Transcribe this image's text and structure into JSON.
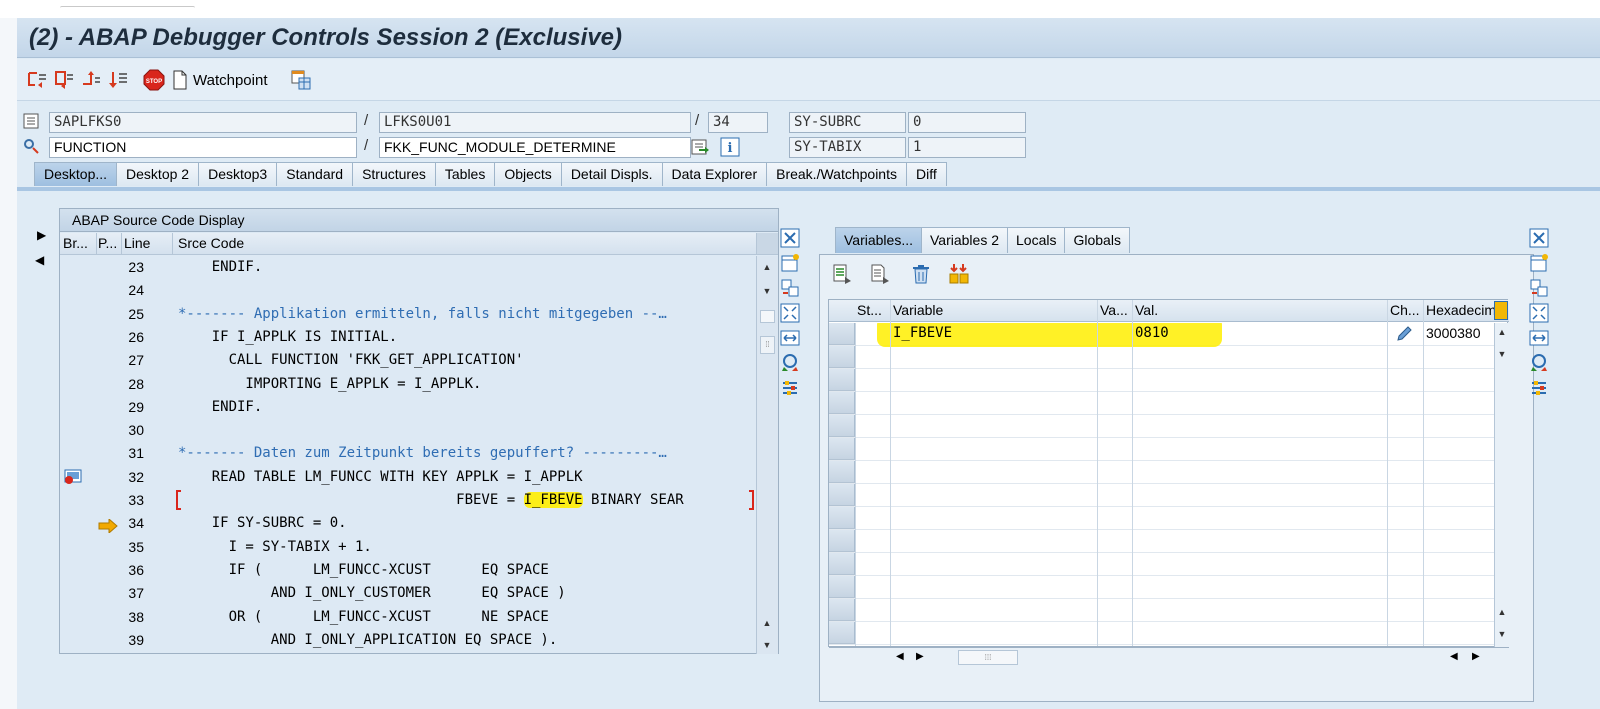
{
  "window": {
    "title": "(2) - ABAP Debugger Controls Session 2 (Exclusive)"
  },
  "toolbar": {
    "buttons": [
      "single-step-icon",
      "execute-icon",
      "return-icon",
      "continue-icon"
    ],
    "stop_icon": "stop-icon",
    "watchpoint_label": "Watchpoint",
    "layout_icon": "layout-icon"
  },
  "info": {
    "program": "SAPLFKS0",
    "include": "LFKS0U01",
    "line": "34",
    "sy_subrc_label": "SY-SUBRC",
    "sy_subrc_value": "0",
    "event_type": "FUNCTION",
    "event_name": "FKK_FUNC_MODULE_DETERMINE",
    "sy_tabix_label": "SY-TABIX",
    "sy_tabix_value": "1"
  },
  "main_tabs": [
    "Desktop...",
    "Desktop 2",
    "Desktop3",
    "Standard",
    "Structures",
    "Tables",
    "Objects",
    "Detail Displs.",
    "Data Explorer",
    "Break./Watchpoints",
    "Diff"
  ],
  "source": {
    "panel_title": "ABAP Source Code Display",
    "col_br": "Br...",
    "col_p": "P...",
    "col_line": "Line",
    "col_code": "Srce Code",
    "lines": [
      {
        "no": "23",
        "code": "    ENDIF."
      },
      {
        "no": "24",
        "code": ""
      },
      {
        "no": "25",
        "code": "*------- Applikation ermitteln, falls nicht mitgegeben --…",
        "comment": true
      },
      {
        "no": "26",
        "code": "    IF I_APPLK IS INITIAL."
      },
      {
        "no": "27",
        "code": "      CALL FUNCTION 'FKK_GET_APPLICATION'"
      },
      {
        "no": "28",
        "code": "        IMPORTING E_APPLK = I_APPLK."
      },
      {
        "no": "29",
        "code": "    ENDIF."
      },
      {
        "no": "30",
        "code": ""
      },
      {
        "no": "31",
        "code": "*------- Daten zum Zeitpunkt bereits gepuffert? ---------…",
        "comment": true
      },
      {
        "no": "32",
        "code": "    READ TABLE LM_FUNCC WITH KEY APPLK = I_APPLK"
      },
      {
        "no": "33",
        "code": "                                 FBEVE = I_FBEVE BINARY SEAR"
      },
      {
        "no": "34",
        "code": "    IF SY-SUBRC = 0."
      },
      {
        "no": "35",
        "code": "      I = SY-TABIX + 1."
      },
      {
        "no": "36",
        "code": "      IF (      LM_FUNCC-XCUST      EQ SPACE"
      },
      {
        "no": "37",
        "code": "           AND I_ONLY_CUSTOMER      EQ SPACE )"
      },
      {
        "no": "38",
        "code": "      OR (      LM_FUNCC-XCUST      NE SPACE"
      },
      {
        "no": "39",
        "code": "           AND I_ONLY_APPLICATION EQ SPACE )."
      }
    ]
  },
  "vars": {
    "tabs": [
      "Variables...",
      "Variables 2",
      "Locals",
      "Globals"
    ],
    "columns": {
      "st": "St...",
      "variable": "Variable",
      "va": "Va...",
      "val": "Val.",
      "ch": "Ch...",
      "hex": "Hexadecim"
    },
    "row1": {
      "variable": "I_FBEVE",
      "value": "0810",
      "hex": "3000380"
    }
  },
  "colors": {
    "highlight": "#ffee00",
    "comment": "#2f6db3",
    "active_tab": "#a9c6e3"
  }
}
